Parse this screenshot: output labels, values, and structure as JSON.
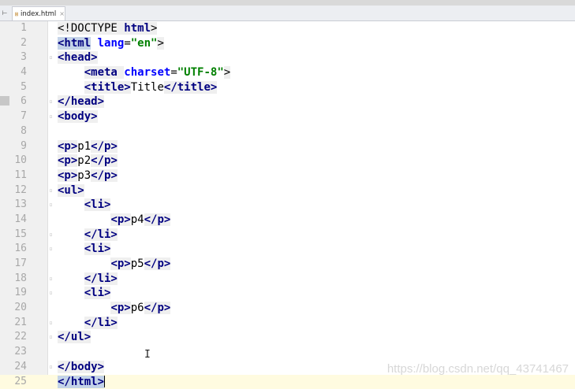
{
  "tab": {
    "filename": "index.html",
    "close_glyph": "×",
    "nav_glyph": "⊢"
  },
  "lines": [
    {
      "n": "1",
      "tokens": [
        [
          "punc",
          "<!DOCTYPE "
        ],
        [
          "tag",
          "html"
        ],
        [
          "punc",
          ">"
        ]
      ]
    },
    {
      "n": "2",
      "tokens": [
        [
          "tag-hl",
          "<html"
        ],
        [
          "txt",
          " "
        ],
        [
          "attr",
          "lang"
        ],
        [
          "txt",
          "="
        ],
        [
          "str",
          "\"en\""
        ],
        [
          "punc",
          ">"
        ]
      ]
    },
    {
      "n": "3",
      "tokens": [
        [
          "tag",
          "<head>"
        ]
      ]
    },
    {
      "n": "4",
      "tokens": [
        [
          "txt",
          "    "
        ],
        [
          "tag",
          "<meta "
        ],
        [
          "attr",
          "charset"
        ],
        [
          "txt",
          "="
        ],
        [
          "str",
          "\"UTF-8\""
        ],
        [
          "punc",
          ">"
        ]
      ]
    },
    {
      "n": "5",
      "tokens": [
        [
          "txt",
          "    "
        ],
        [
          "tag",
          "<title>"
        ],
        [
          "txt",
          "Title"
        ],
        [
          "tag",
          "</title>"
        ]
      ]
    },
    {
      "n": "6",
      "tokens": [
        [
          "tag",
          "</head>"
        ]
      ]
    },
    {
      "n": "7",
      "tokens": [
        [
          "tag",
          "<body>"
        ]
      ]
    },
    {
      "n": "8",
      "tokens": []
    },
    {
      "n": "9",
      "tokens": [
        [
          "tag",
          "<p>"
        ],
        [
          "txt",
          "p1"
        ],
        [
          "tag",
          "</p>"
        ]
      ]
    },
    {
      "n": "10",
      "tokens": [
        [
          "tag",
          "<p>"
        ],
        [
          "txt",
          "p2"
        ],
        [
          "tag",
          "</p>"
        ]
      ]
    },
    {
      "n": "11",
      "tokens": [
        [
          "tag",
          "<p>"
        ],
        [
          "txt",
          "p3"
        ],
        [
          "tag",
          "</p>"
        ]
      ]
    },
    {
      "n": "12",
      "tokens": [
        [
          "tag",
          "<ul>"
        ]
      ]
    },
    {
      "n": "13",
      "tokens": [
        [
          "txt",
          "    "
        ],
        [
          "tag",
          "<li>"
        ]
      ]
    },
    {
      "n": "14",
      "tokens": [
        [
          "txt",
          "        "
        ],
        [
          "tag",
          "<p>"
        ],
        [
          "txt",
          "p4"
        ],
        [
          "tag",
          "</p>"
        ]
      ]
    },
    {
      "n": "15",
      "tokens": [
        [
          "txt",
          "    "
        ],
        [
          "tag",
          "</li>"
        ]
      ]
    },
    {
      "n": "16",
      "tokens": [
        [
          "txt",
          "    "
        ],
        [
          "tag",
          "<li>"
        ]
      ]
    },
    {
      "n": "17",
      "tokens": [
        [
          "txt",
          "        "
        ],
        [
          "tag",
          "<p>"
        ],
        [
          "txt",
          "p5"
        ],
        [
          "tag",
          "</p>"
        ]
      ]
    },
    {
      "n": "18",
      "tokens": [
        [
          "txt",
          "    "
        ],
        [
          "tag",
          "</li>"
        ]
      ]
    },
    {
      "n": "19",
      "tokens": [
        [
          "txt",
          "    "
        ],
        [
          "tag",
          "<li>"
        ]
      ]
    },
    {
      "n": "20",
      "tokens": [
        [
          "txt",
          "        "
        ],
        [
          "tag",
          "<p>"
        ],
        [
          "txt",
          "p6"
        ],
        [
          "tag",
          "</p>"
        ]
      ]
    },
    {
      "n": "21",
      "tokens": [
        [
          "txt",
          "    "
        ],
        [
          "tag",
          "</li>"
        ]
      ]
    },
    {
      "n": "22",
      "tokens": [
        [
          "tag",
          "</ul>"
        ]
      ]
    },
    {
      "n": "23",
      "tokens": []
    },
    {
      "n": "24",
      "tokens": [
        [
          "tag",
          "</body>"
        ]
      ]
    },
    {
      "n": "25",
      "tokens": [
        [
          "tag-hl",
          "</html>"
        ]
      ],
      "current": true,
      "caret": true
    }
  ],
  "watermark": "https://blog.csdn.net/qq_43741467",
  "cursor_glyph": "I",
  "colors": {
    "tag": "#000080",
    "attribute": "#0000ff",
    "string": "#008000",
    "current_line": "#fffbe0",
    "gutter": "#f0f0f0"
  }
}
